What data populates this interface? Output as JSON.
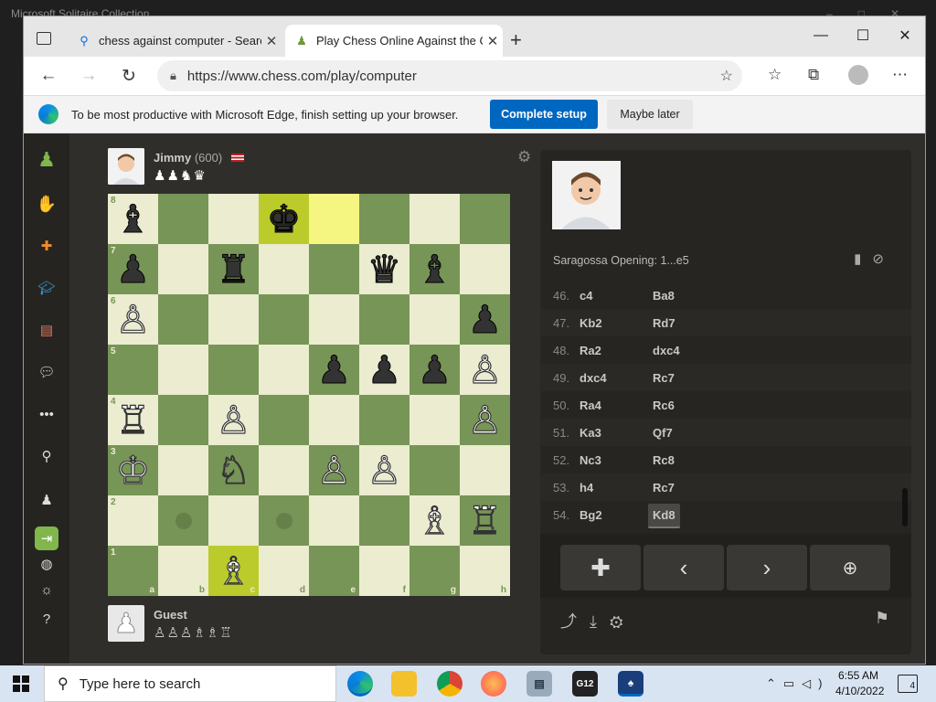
{
  "background_window": {
    "title": "Microsoft Solitaire Collection"
  },
  "browser": {
    "tabs": [
      {
        "title": "chess against computer - Search",
        "favicon": "search-icon"
      },
      {
        "title": "Play Chess Online Against the Co",
        "favicon": "chess-pawn-icon"
      }
    ],
    "url": "https://www.chess.com/play/computer"
  },
  "infobar": {
    "message": "To be most productive with Microsoft Edge, finish setting up your browser.",
    "primary_label": "Complete setup",
    "secondary_label": "Maybe later"
  },
  "opponent": {
    "name": "Jimmy",
    "rating": "(600)",
    "captured": "♟♟♞♛"
  },
  "player": {
    "name": "Guest",
    "captured": "♙♙♙♗♗♖"
  },
  "board": {
    "squares": [
      [
        "b♝",
        "",
        "",
        "b♚",
        "",
        "",
        "",
        ""
      ],
      [
        "b♟",
        "",
        "b♜",
        "",
        "",
        "b♛",
        "b♝",
        ""
      ],
      [
        "w♙",
        "",
        "",
        "",
        "",
        "",
        "",
        "b♟"
      ],
      [
        "",
        "",
        "",
        "",
        "b♟",
        "b♟",
        "b♟",
        "w♙"
      ],
      [
        "w♖",
        "",
        "w♙",
        "",
        "",
        "",
        "",
        "w♙"
      ],
      [
        "w♔",
        "",
        "w♘",
        "",
        "w♙",
        "w♙",
        "",
        ""
      ],
      [
        "",
        "",
        "",
        "",
        "",
        "",
        "w♗",
        "w♖"
      ],
      [
        "",
        "",
        "w♗",
        "",
        "",
        "",
        "",
        ""
      ]
    ],
    "highlights": [
      "d8",
      "e8",
      "c1"
    ],
    "move_dots": [
      "b2",
      "d2"
    ],
    "ranks": [
      "8",
      "7",
      "6",
      "5",
      "4",
      "3",
      "2",
      "1"
    ],
    "files": [
      "a",
      "b",
      "c",
      "d",
      "e",
      "f",
      "g",
      "h"
    ]
  },
  "panel": {
    "opening": "Saragossa Opening: 1...e5",
    "moves": [
      {
        "no": "46.",
        "white": "c4",
        "black": "Ba8"
      },
      {
        "no": "47.",
        "white": "Kb2",
        "black": "Rd7"
      },
      {
        "no": "48.",
        "white": "Ra2",
        "black": "dxc4"
      },
      {
        "no": "49.",
        "white": "dxc4",
        "black": "Rc7"
      },
      {
        "no": "50.",
        "white": "Ra4",
        "black": "Rc6"
      },
      {
        "no": "51.",
        "white": "Ka3",
        "black": "Qf7"
      },
      {
        "no": "52.",
        "white": "Nc3",
        "black": "Rc8"
      },
      {
        "no": "53.",
        "white": "h4",
        "black": "Rc7"
      },
      {
        "no": "54.",
        "white": "Bg2",
        "black": "Kd8"
      }
    ],
    "current_move": "Kd8"
  },
  "taskbar": {
    "search_placeholder": "Type here to search",
    "time": "6:55 AM",
    "date": "4/10/2022",
    "notifications": "4"
  }
}
